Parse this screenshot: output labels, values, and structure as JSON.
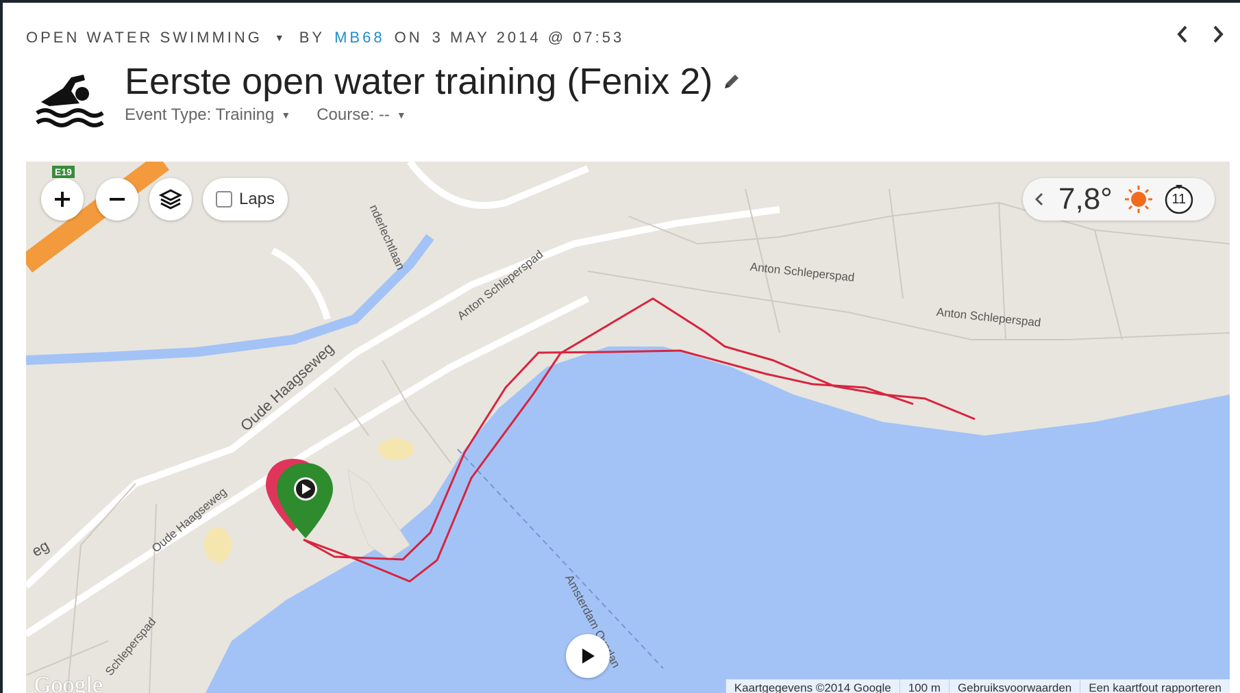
{
  "header": {
    "activity_type": "OPEN WATER SWIMMING",
    "by": "BY",
    "author": "MB68",
    "on": "ON",
    "date": "3 MAY 2014 @ 07:53",
    "title": "Eerste open water training (Fenix 2)",
    "event_type": "Event Type: Training",
    "course": "Course: --"
  },
  "map": {
    "laps_label": "Laps",
    "temperature": "7,8°",
    "wind_speed": "11",
    "attribution": {
      "map_data": "Kaartgegevens ©2014 Google",
      "scale": "100 m",
      "terms": "Gebruiksvoorwaarden",
      "report": "Een kaartfout rapporteren"
    },
    "google_logo": "Google",
    "road_shield": "E19",
    "labels": {
      "anton1": "Anton Schleperspad",
      "anton2": "Anton Schleperspad",
      "anton3": "Anton Schleperspad",
      "anton4": "Schleperspad",
      "oude1": "Oude Haagseweg",
      "oude2": "Oude Haagseweg",
      "anderlecht": "nderlechtlaan",
      "amsterdam": "Amsterdam Overlan",
      "weg": "eg"
    },
    "colors": {
      "water": "#a3c3f7",
      "land": "#e8e5de",
      "track": "#d8243f",
      "start_marker": "#2e8b2e",
      "end_marker": "#e0355b"
    }
  },
  "icons": {
    "activity": "swimmer-icon",
    "edit": "pencil-icon",
    "prev": "chevron-left-icon",
    "next": "chevron-right-icon",
    "zoom_in": "plus-icon",
    "zoom_out": "minus-icon",
    "layers": "layers-icon",
    "weather": "sun-icon",
    "wind": "wind-direction-icon",
    "play": "play-icon"
  }
}
